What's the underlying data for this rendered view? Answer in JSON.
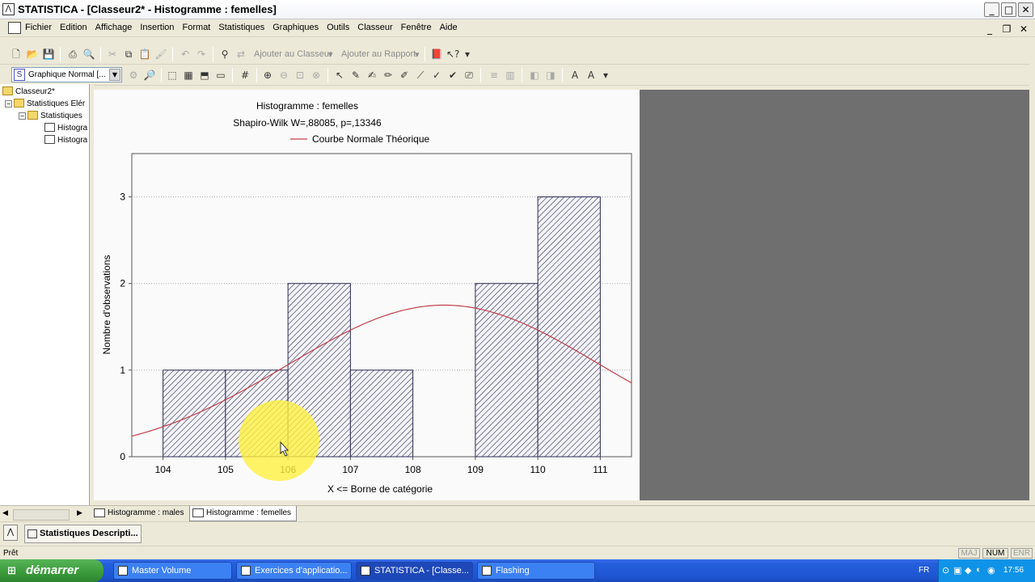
{
  "window": {
    "app_icon": "statistica-icon",
    "title": "STATISTICA - [Classeur2* - Histogramme : femelles]",
    "minimize": "_",
    "maximize": "□",
    "close": "✕"
  },
  "menu": {
    "items": [
      "Fichier",
      "Edition",
      "Affichage",
      "Insertion",
      "Format",
      "Statistiques",
      "Graphiques",
      "Outils",
      "Classeur",
      "Fenêtre",
      "Aide"
    ]
  },
  "toolbar1": {
    "add_to_workbook": "Ajouter au Classeur",
    "add_to_report": "Ajouter au Rapport"
  },
  "toolbar2": {
    "graph_type": "Graphique Normal [..."
  },
  "tree": {
    "root": "Classeur2*",
    "level1": "Statistiques Elér",
    "level2": "Statistiques",
    "leaf1": "Histogra",
    "leaf2": "Histogra"
  },
  "tabs": {
    "males": "Histogramme : males",
    "femelles": "Histogramme : femelles"
  },
  "report": {
    "button": "Statistiques Descripti..."
  },
  "status": {
    "ready": "Prêt",
    "maj": "MAJ",
    "num": "NUM",
    "enr": "ENR"
  },
  "taskbar": {
    "start": "démarrer",
    "tasks": [
      "Master Volume",
      "Exercices d'applicatio...",
      "STATISTICA - [Classe...",
      "Flashing"
    ],
    "lang": "FR",
    "clock": "17:56"
  },
  "colors": {
    "curve": "#C0404A",
    "bar_hatch": "#2A2A55",
    "highlight": "#FFF040"
  },
  "chart_data": {
    "type": "bar",
    "title": "Histogramme : femelles",
    "subtitle": "Shapiro-Wilk W=,88085, p=,13346",
    "legend": [
      "Courbe Normale Théorique"
    ],
    "legend_position": "top",
    "xlabel": "X <= Borne de catégorie",
    "ylabel": "Nombre d'observations",
    "x_ticks": [
      "104",
      "105",
      "106",
      "107",
      "108",
      "109",
      "110",
      "111"
    ],
    "y_ticks": [
      "0",
      "1",
      "2",
      "3"
    ],
    "xlim": [
      103.5,
      111.5
    ],
    "ylim": [
      0,
      3.5
    ],
    "grid": true,
    "bins": [
      {
        "from": 104,
        "to": 105,
        "count": 1
      },
      {
        "from": 105,
        "to": 106,
        "count": 1
      },
      {
        "from": 106,
        "to": 107,
        "count": 2
      },
      {
        "from": 107,
        "to": 108,
        "count": 1
      },
      {
        "from": 108,
        "to": 109,
        "count": 0
      },
      {
        "from": 109,
        "to": 110,
        "count": 2
      },
      {
        "from": 110,
        "to": 111,
        "count": 3
      }
    ],
    "normal_curve": {
      "mean": 108.5,
      "sd": 2.5,
      "scale": 1.75
    }
  }
}
